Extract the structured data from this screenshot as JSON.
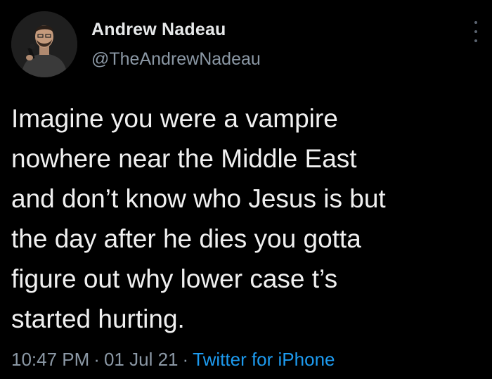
{
  "author": {
    "display_name": "Andrew Nadeau",
    "handle": "@TheAndrewNadeau",
    "avatar_icon": "profile-photo"
  },
  "tweet": {
    "text": "Imagine you were a vampire\nnowhere near the Middle East\nand don’t know who Jesus is but\nthe day after he dies you gotta\nfigure out why lower case t’s\nstarted hurting.",
    "time": "10:47 PM",
    "date": "01 Jul 21",
    "separator": "·",
    "source": "Twitter for iPhone"
  },
  "colors": {
    "background": "#000000",
    "text": "#e7e9ea",
    "muted": "#8b98a5",
    "link": "#1d9bf0"
  },
  "icons": {
    "menu": "more-vertical-icon"
  }
}
